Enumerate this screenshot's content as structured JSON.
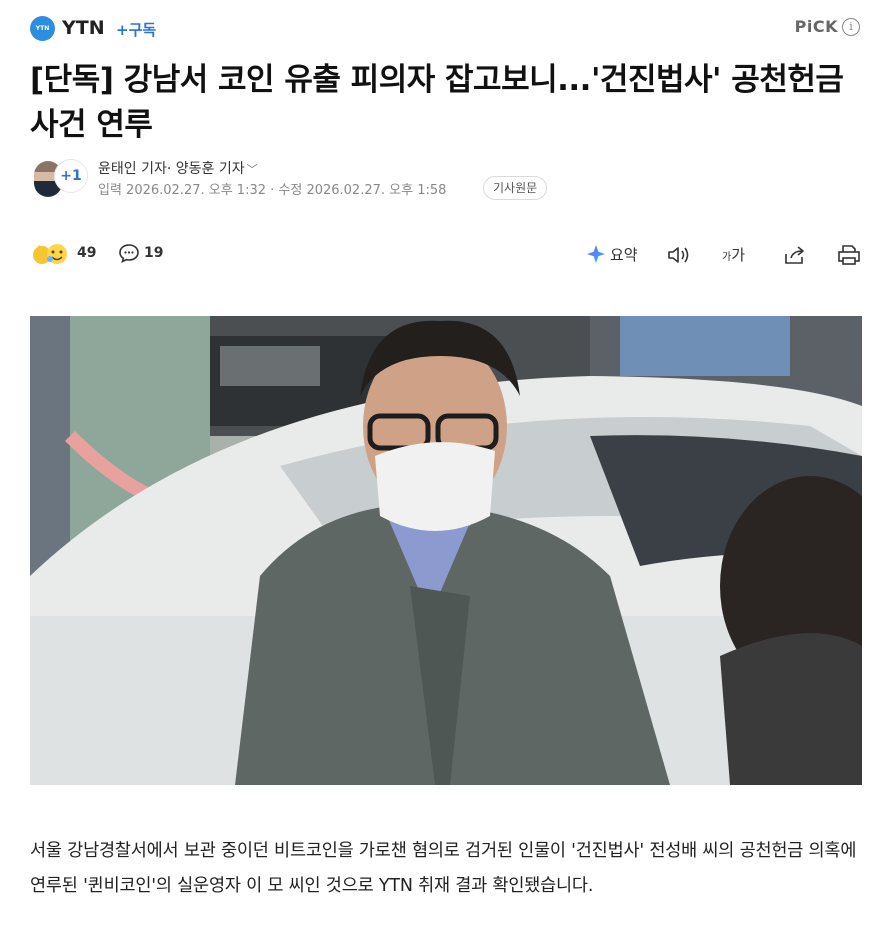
{
  "header": {
    "logo_text": "YTN",
    "press_name": "YTN",
    "subscribe_label": "+구독",
    "pick_label": "PiCK",
    "info_label": "i"
  },
  "article": {
    "title": "[단독] 강남서 코인 유출 피의자 잡고보니...'건진법사' 공천헌금 사건 연루",
    "reporters": "윤태인 기자· 양동훈 기자",
    "follow_badge": "+1",
    "dates": "입력 2026.02.27. 오후 1:32 · 수정 2026.02.27. 오후 1:58",
    "original_button": "기사원문",
    "body": "서울 강남경찰서에서 보관 중이던 비트코인을 가로챈 혐의로 검거된 인물이 '건진법사' 전성배 씨의 공천헌금 의혹에 연루된 '퀸비코인'의 실운영자 이 모 씨인 것으로 YTN 취재 결과 확인됐습니다."
  },
  "actions": {
    "reaction_count": "49",
    "comment_count": "19",
    "summary_label": "요약",
    "fontsize_small": "가",
    "fontsize_large": "가"
  },
  "colors": {
    "accent_blue": "#2d73d6",
    "logo_blue": "#2d8ee0"
  }
}
